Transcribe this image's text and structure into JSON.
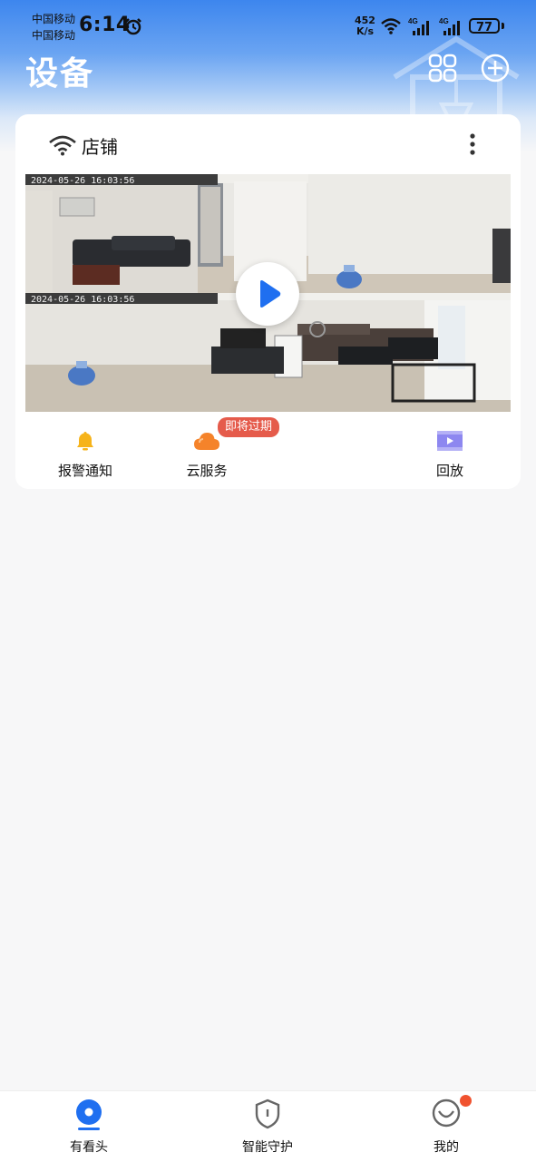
{
  "status_bar": {
    "carrier_1": "中国移动",
    "carrier_2": "中国移动",
    "time": "6:14",
    "net_speed_value": "452",
    "net_speed_unit": "K/s",
    "signal_1_label": "4G",
    "signal_2_label": "4G",
    "battery": "77"
  },
  "header": {
    "title": "设备",
    "grid_icon": "grid-view-icon",
    "add_icon": "add-circle-icon"
  },
  "device_card": {
    "name": "店铺",
    "connection_icon": "wifi-icon",
    "more_icon": "more-vertical-icon",
    "preview": {
      "timestamp_top": "2024-05-26   16:03:56",
      "timestamp_bottom": "2024-05-26   16:03:56",
      "play_icon": "play-icon"
    },
    "actions": [
      {
        "label": "报警通知",
        "icon": "bell-icon",
        "color": "#f6b31a"
      },
      {
        "label": "云服务",
        "icon": "cloud-icon",
        "color": "#f5832a",
        "badge": "即将过期"
      },
      {
        "label": "回放",
        "icon": "playback-icon",
        "color": "#8d87f0"
      }
    ]
  },
  "bottom_nav": {
    "items": [
      {
        "label": "有看头",
        "icon": "home-camera-icon",
        "active": true
      },
      {
        "label": "智能守护",
        "icon": "shield-icon",
        "active": false
      },
      {
        "label": "我的",
        "icon": "profile-icon",
        "active": false,
        "has_notification": true
      }
    ]
  },
  "colors": {
    "accent": "#1f6ff0",
    "header_gradient_top": "#3d86ee",
    "badge": "#e55b4b",
    "notification_dot": "#f0522f",
    "page_background": "#f7f7f8"
  }
}
